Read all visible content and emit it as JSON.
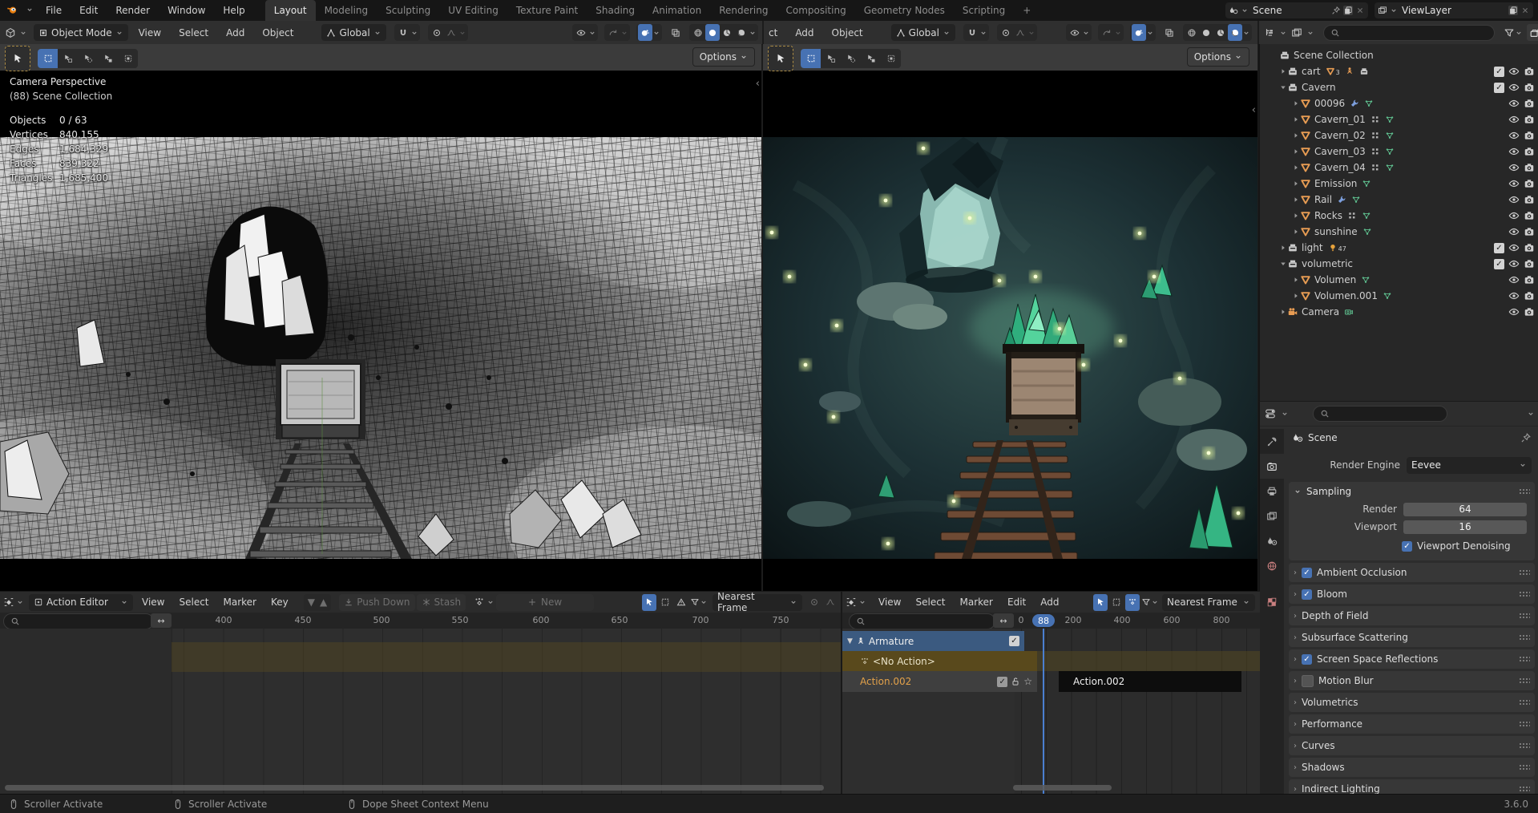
{
  "colors": {
    "accent": "#4772b3",
    "mesh_orange": "#e79c53",
    "data_green": "#5fc08f",
    "wrench_blue": "#7d9fdd",
    "action_text": "#e2a14a",
    "olive_row": "#59491c",
    "selected_channel": "#3b5a80"
  },
  "topbar": {
    "menus": [
      "File",
      "Edit",
      "Render",
      "Window",
      "Help"
    ],
    "workspaces": [
      {
        "label": "Layout",
        "active": true
      },
      {
        "label": "Modeling"
      },
      {
        "label": "Sculpting"
      },
      {
        "label": "UV Editing"
      },
      {
        "label": "Texture Paint"
      },
      {
        "label": "Shading"
      },
      {
        "label": "Animation"
      },
      {
        "label": "Rendering"
      },
      {
        "label": "Compositing"
      },
      {
        "label": "Geometry Nodes"
      },
      {
        "label": "Scripting"
      }
    ],
    "new_workspace": "+",
    "scene": {
      "label": "Scene"
    },
    "view_layer": {
      "label": "ViewLayer"
    }
  },
  "viewport_left": {
    "header": {
      "mode": "Object Mode",
      "menus": [
        "View",
        "Select",
        "Add",
        "Object"
      ],
      "orientation": "Global",
      "options": "Options"
    },
    "overlay": {
      "title": "Camera Perspective",
      "subtitle": "(88) Scene Collection",
      "stats": [
        {
          "label": "Objects",
          "value": "0 / 63"
        },
        {
          "label": "Vertices",
          "value": "840,155"
        },
        {
          "label": "Edges",
          "value": "1,684,329"
        },
        {
          "label": "Faces",
          "value": "839,322"
        },
        {
          "label": "Triangles",
          "value": "1,685,400"
        }
      ]
    }
  },
  "viewport_right": {
    "header": {
      "truncated": "ct",
      "menus": [
        "Add",
        "Object"
      ],
      "orientation": "Global",
      "options": "Options"
    }
  },
  "outliner": {
    "root": "Scene Collection",
    "items": [
      {
        "indent": 1,
        "disc": "closed",
        "icon": "collection",
        "label": "cart",
        "badges": [
          {
            "icon": "mesh",
            "color": "#e79c53",
            "sub": "3"
          },
          {
            "icon": "armature",
            "color": "#e79c53"
          },
          {
            "icon": "collection",
            "color": "#c9c9c9"
          }
        ],
        "check": true,
        "eye": true,
        "cam": true
      },
      {
        "indent": 1,
        "disc": "open",
        "icon": "collection",
        "label": "Cavern",
        "check": true,
        "eye": true,
        "cam": true
      },
      {
        "indent": 2,
        "disc": "closed",
        "icon": "mesh",
        "label": "00096",
        "badges": [
          {
            "icon": "wrench",
            "color": "#7d9fdd"
          },
          {
            "icon": "meshdata",
            "color": "#5fc08f"
          }
        ],
        "eye": true,
        "cam": true
      },
      {
        "indent": 2,
        "disc": "closed",
        "icon": "mesh",
        "label": "Cavern_01",
        "badges": [
          {
            "icon": "modifier",
            "color": "#b0b0b0"
          },
          {
            "icon": "meshdata",
            "color": "#5fc08f"
          }
        ],
        "eye": true,
        "cam": true
      },
      {
        "indent": 2,
        "disc": "closed",
        "icon": "mesh",
        "label": "Cavern_02",
        "badges": [
          {
            "icon": "modifier",
            "color": "#b0b0b0"
          },
          {
            "icon": "meshdata",
            "color": "#5fc08f"
          }
        ],
        "eye": true,
        "cam": true
      },
      {
        "indent": 2,
        "disc": "closed",
        "icon": "mesh",
        "label": "Cavern_03",
        "badges": [
          {
            "icon": "modifier",
            "color": "#b0b0b0"
          },
          {
            "icon": "meshdata",
            "color": "#5fc08f"
          }
        ],
        "eye": true,
        "cam": true
      },
      {
        "indent": 2,
        "disc": "closed",
        "icon": "mesh",
        "label": "Cavern_04",
        "badges": [
          {
            "icon": "modifier",
            "color": "#b0b0b0"
          },
          {
            "icon": "meshdata",
            "color": "#5fc08f"
          }
        ],
        "eye": true,
        "cam": true
      },
      {
        "indent": 2,
        "disc": "closed",
        "icon": "mesh",
        "label": "Emission",
        "badges": [
          {
            "icon": "meshdata",
            "color": "#5fc08f"
          }
        ],
        "eye": true,
        "cam": true
      },
      {
        "indent": 2,
        "disc": "closed",
        "icon": "mesh",
        "label": "Rail",
        "badges": [
          {
            "icon": "wrench",
            "color": "#7d9fdd"
          },
          {
            "icon": "meshdata",
            "color": "#5fc08f"
          }
        ],
        "eye": true,
        "cam": true
      },
      {
        "indent": 2,
        "disc": "closed",
        "icon": "mesh",
        "label": "Rocks",
        "badges": [
          {
            "icon": "modifier",
            "color": "#b0b0b0"
          },
          {
            "icon": "meshdata",
            "color": "#5fc08f"
          }
        ],
        "eye": true,
        "cam": true
      },
      {
        "indent": 2,
        "disc": "closed",
        "icon": "mesh",
        "label": "sunshine",
        "badges": [
          {
            "icon": "meshdata",
            "color": "#5fc08f"
          }
        ],
        "eye": true,
        "cam": true
      },
      {
        "indent": 1,
        "disc": "closed",
        "icon": "collection",
        "label": "light",
        "badges": [
          {
            "icon": "bulb",
            "color": "#e7a33c",
            "sub": "47"
          }
        ],
        "check": true,
        "eye": true,
        "cam": true
      },
      {
        "indent": 1,
        "disc": "open",
        "icon": "collection",
        "label": "volumetric",
        "check": true,
        "eye": true,
        "cam": true
      },
      {
        "indent": 2,
        "disc": "closed",
        "icon": "mesh",
        "label": "Volumen",
        "badges": [
          {
            "icon": "meshdata",
            "color": "#5fc08f"
          }
        ],
        "eye": true,
        "cam": true
      },
      {
        "indent": 2,
        "disc": "closed",
        "icon": "mesh",
        "label": "Volumen.001",
        "badges": [
          {
            "icon": "meshdata",
            "color": "#5fc08f"
          }
        ],
        "eye": true,
        "cam": true
      },
      {
        "indent": 1,
        "disc": "closed",
        "icon": "camera",
        "label": "Camera",
        "badges": [
          {
            "icon": "camdata",
            "color": "#5fc08f"
          }
        ],
        "eye": true,
        "cam": true
      }
    ]
  },
  "properties": {
    "breadcrumb": "Scene",
    "render_engine_label": "Render Engine",
    "render_engine": "Eevee",
    "sampling": {
      "title": "Sampling",
      "render_label": "Render",
      "render_value": "64",
      "viewport_label": "Viewport",
      "viewport_value": "16",
      "denoise_label": "Viewport Denoising",
      "denoise": true
    },
    "panels": [
      {
        "label": "Ambient Occlusion",
        "check": true
      },
      {
        "label": "Bloom",
        "check": true
      },
      {
        "label": "Depth of Field"
      },
      {
        "label": "Subsurface Scattering"
      },
      {
        "label": "Screen Space Reflections",
        "check": true
      },
      {
        "label": "Motion Blur",
        "check": false
      },
      {
        "label": "Volumetrics"
      },
      {
        "label": "Performance"
      },
      {
        "label": "Curves"
      },
      {
        "label": "Shadows"
      },
      {
        "label": "Indirect Lighting"
      }
    ]
  },
  "dopesheet_left": {
    "mode": "Action Editor",
    "menus": [
      "View",
      "Select",
      "Marker",
      "Key"
    ],
    "push_down": "Push Down",
    "stash": "Stash",
    "new_action": "New",
    "snap": "Nearest Frame",
    "ruler": [
      "400",
      "450",
      "500",
      "550",
      "600",
      "650",
      "700",
      "750"
    ]
  },
  "dopesheet_right": {
    "menus": [
      "View",
      "Select",
      "Marker",
      "Edit",
      "Add"
    ],
    "snap": "Nearest Frame",
    "ruler": [
      "0",
      "200",
      "400",
      "600",
      "800"
    ],
    "current_frame": "88",
    "channels": {
      "armature": "Armature",
      "no_action": "<No Action>",
      "action": "Action.002"
    },
    "strip_label": "Action.002"
  },
  "statusbar": {
    "items": [
      "Scroller Activate",
      "Scroller Activate",
      "Dope Sheet Context Menu"
    ],
    "version": "3.6.0"
  }
}
